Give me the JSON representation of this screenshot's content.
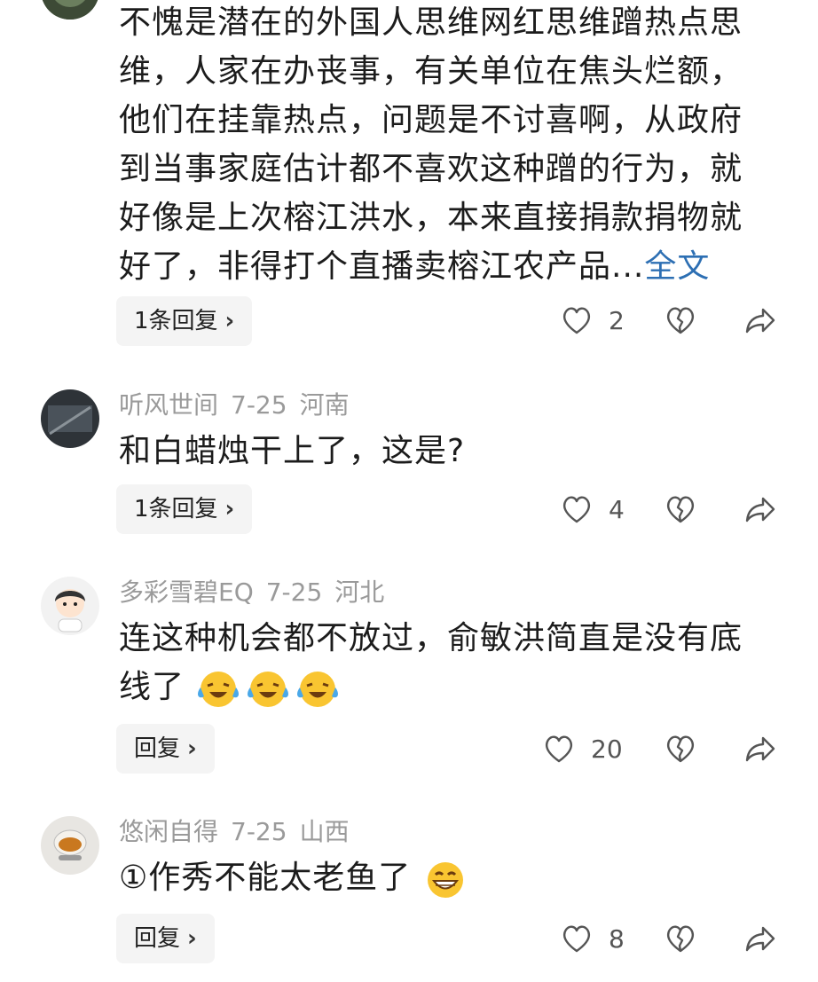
{
  "comments": [
    {
      "text": "不愧是潜在的外国人思维网红思维蹭热点思维，人家在办丧事，有关单位在焦头烂额，他们在挂靠热点，问题是不讨喜啊，从政府到当事家庭估计都不喜欢这种蹭的行为，就好像是上次榕江洪水，本来直接捐款捐物就好了，非得打个直播卖榕江农产品...",
      "more_label": "全文",
      "reply_label": "1条回复",
      "likes": "2"
    },
    {
      "username": "听风世间",
      "date": "7-25",
      "location": "河南",
      "text": "和白蜡烛干上了，这是?",
      "reply_label": "1条回复",
      "likes": "4"
    },
    {
      "username": "多彩雪碧EQ",
      "date": "7-25",
      "location": "河北",
      "text": "连这种机会都不放过，俞敏洪简直是没有底线了",
      "emojis": [
        "laugh-cry-emoji",
        "laugh-cry-emoji",
        "laugh-cry-emoji"
      ],
      "reply_label": "回复",
      "likes": "20"
    },
    {
      "username": "悠闲自得",
      "date": "7-25",
      "location": "山西",
      "text": "①作秀不能太老鱼了",
      "emojis": [
        "grin-emoji"
      ],
      "reply_label": "回复",
      "likes": "8"
    }
  ],
  "icons": {
    "like": "heart-icon",
    "dislike": "broken-heart-icon",
    "share": "share-arrow-icon",
    "reply_chevron": "chevron-right-icon"
  },
  "colors": {
    "link": "#2d6fb3",
    "meta": "#9a9a9a",
    "reply_bg": "#f4f4f4"
  }
}
